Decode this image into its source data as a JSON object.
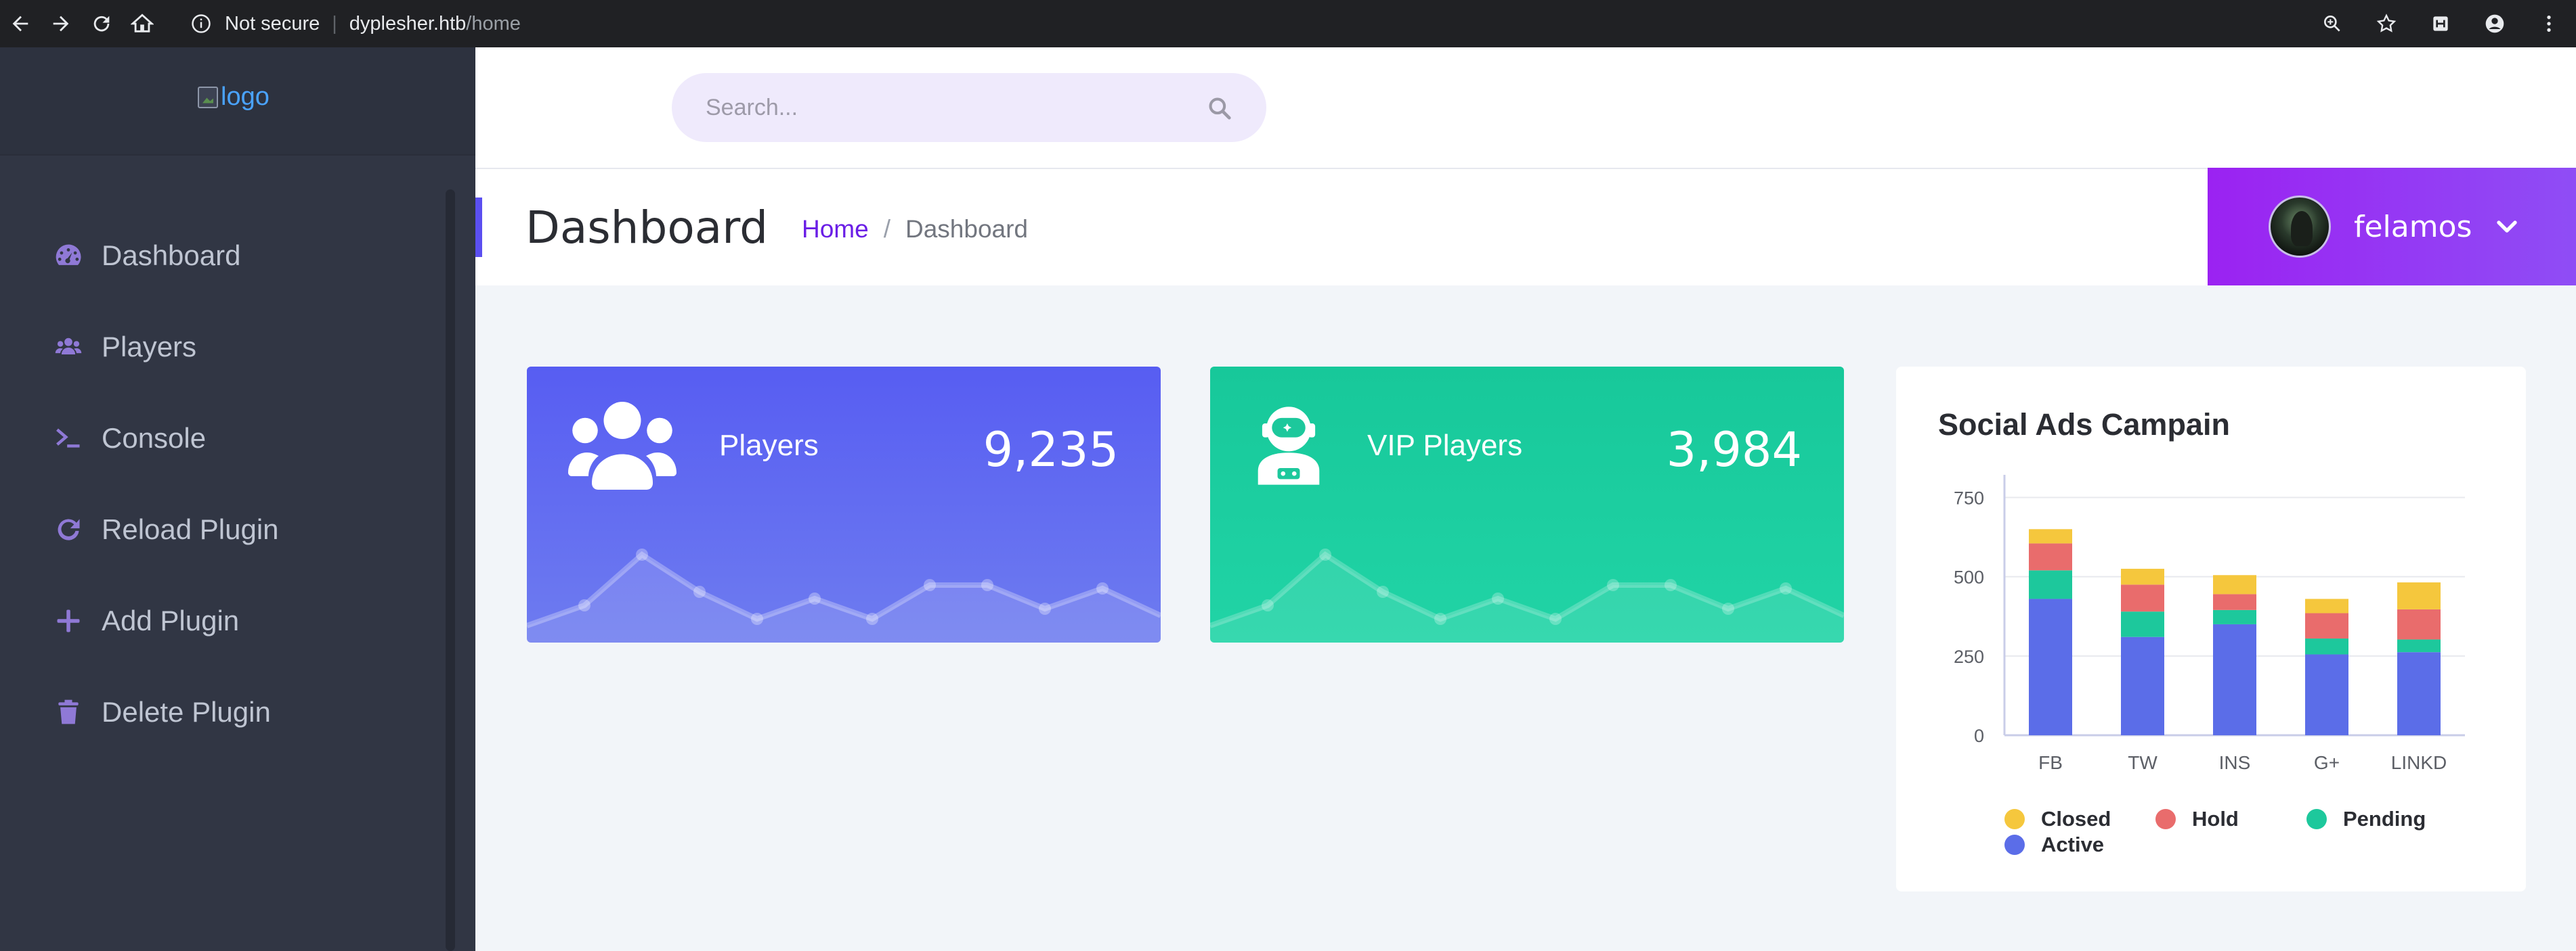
{
  "browser": {
    "not_secure": "Not secure",
    "url_host": "dyplesher.htb",
    "url_path": "/home"
  },
  "sidebar": {
    "logo_alt": "logo",
    "items": [
      {
        "label": "Dashboard",
        "icon": "dashboard-icon"
      },
      {
        "label": "Players",
        "icon": "users-icon"
      },
      {
        "label": "Console",
        "icon": "terminal-icon"
      },
      {
        "label": "Reload Plugin",
        "icon": "reload-icon"
      },
      {
        "label": "Add Plugin",
        "icon": "plus-icon"
      },
      {
        "label": "Delete Plugin",
        "icon": "trash-icon"
      }
    ]
  },
  "search": {
    "placeholder": "Search..."
  },
  "header": {
    "title": "Dashboard",
    "breadcrumb": {
      "home": "Home",
      "separator": "/",
      "current": "Dashboard"
    },
    "user": {
      "name": "felamos"
    }
  },
  "stats": [
    {
      "label": "Players",
      "value": "9,235",
      "color": "#575df2"
    },
    {
      "label": "VIP Players",
      "value": "3,984",
      "color": "#17c89a"
    }
  ],
  "chart": {
    "title": "Social Ads Campain",
    "legend": [
      "Closed",
      "Hold",
      "Pending",
      "Active"
    ]
  },
  "chart_data": {
    "type": "bar",
    "stacked": true,
    "title": "Social Ads Campain",
    "categories": [
      "FB",
      "TW",
      "INS",
      "G+",
      "LINKD"
    ],
    "series": [
      {
        "name": "Active",
        "color": "#5b6de8",
        "values": [
          430,
          310,
          350,
          255,
          262
        ]
      },
      {
        "name": "Pending",
        "color": "#1dc89c",
        "values": [
          90,
          80,
          45,
          50,
          40
        ]
      },
      {
        "name": "Hold",
        "color": "#e96c6c",
        "values": [
          85,
          85,
          50,
          80,
          95
        ]
      },
      {
        "name": "Closed",
        "color": "#f5c73d",
        "values": [
          45,
          50,
          60,
          45,
          85
        ]
      }
    ],
    "yticks": [
      0,
      250,
      500,
      750
    ],
    "ylim": [
      0,
      800
    ],
    "grid": true,
    "legend_position": "bottom"
  }
}
